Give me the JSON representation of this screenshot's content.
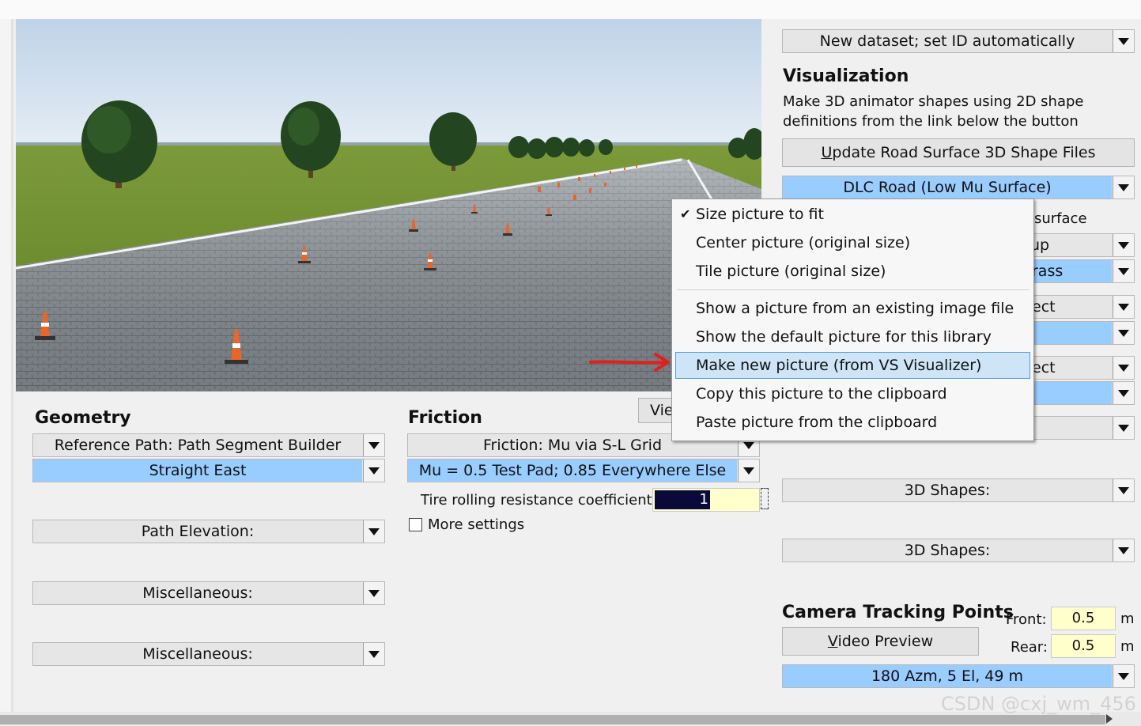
{
  "right_panel": {
    "dataset_combo": "New dataset; set ID automatically",
    "visualization_title": "Visualization",
    "visualization_desc_line1": "Make 3D animator shapes using 2D shape",
    "visualization_desc_line2": "definitions from the link below the button",
    "update_button": "Update Road Surface 3D Shape Files",
    "road_combo": "DLC Road (Low Mu Surface)",
    "partial_surface": "surface",
    "partial_up": "up",
    "partial_grass": "rass",
    "partial_ect1": "ect",
    "partial_ect2": "ect",
    "shapes_combo_1": "3D Shapes:",
    "shapes_combo_2": "3D Shapes:",
    "camera_title": "Camera Tracking Points",
    "video_preview_button": "Video Preview",
    "front_label": "Front:",
    "front_value": "0.5",
    "rear_label": "Rear:",
    "rear_value": "0.5",
    "unit": "m",
    "camera_combo": "180 Azm, 5 El, 49 m"
  },
  "geometry": {
    "title": "Geometry",
    "ref_path_combo": "Reference Path: Path Segment Builder",
    "straight_combo": "Straight East",
    "elevation_combo": "Path Elevation:",
    "misc_combo_1": "Miscellaneous:",
    "misc_combo_2": "Miscellaneous:"
  },
  "friction": {
    "title": "Friction",
    "friction_combo": "Friction: Mu via S-L Grid",
    "mu_combo": "Mu = 0.5 Test Pad; 0.85 Everywhere Else",
    "rr_label": "Tire rolling resistance coefficient:",
    "rr_value": "1",
    "more_settings": "More settings"
  },
  "view_button_partial": "Vie",
  "context_menu": {
    "items": [
      {
        "label": "Size picture to fit",
        "checked": true
      },
      {
        "label": "Center picture (original size)"
      },
      {
        "label": "Tile picture (original size)"
      },
      {
        "label": "Show a picture from an existing image file"
      },
      {
        "label": "Show the default picture for this library"
      },
      {
        "label": "Make new picture (from VS Visualizer)",
        "highlighted": true
      },
      {
        "label": "Copy this picture to the clipboard"
      },
      {
        "label": "Paste picture from the clipboard"
      }
    ],
    "check_glyph": "✔"
  },
  "watermark": "CSDN @cxj_wm_456",
  "colors": {
    "accent_blue": "#99ccff",
    "field_yellow": "#ffffcc",
    "annotation_red": "#e02020"
  }
}
